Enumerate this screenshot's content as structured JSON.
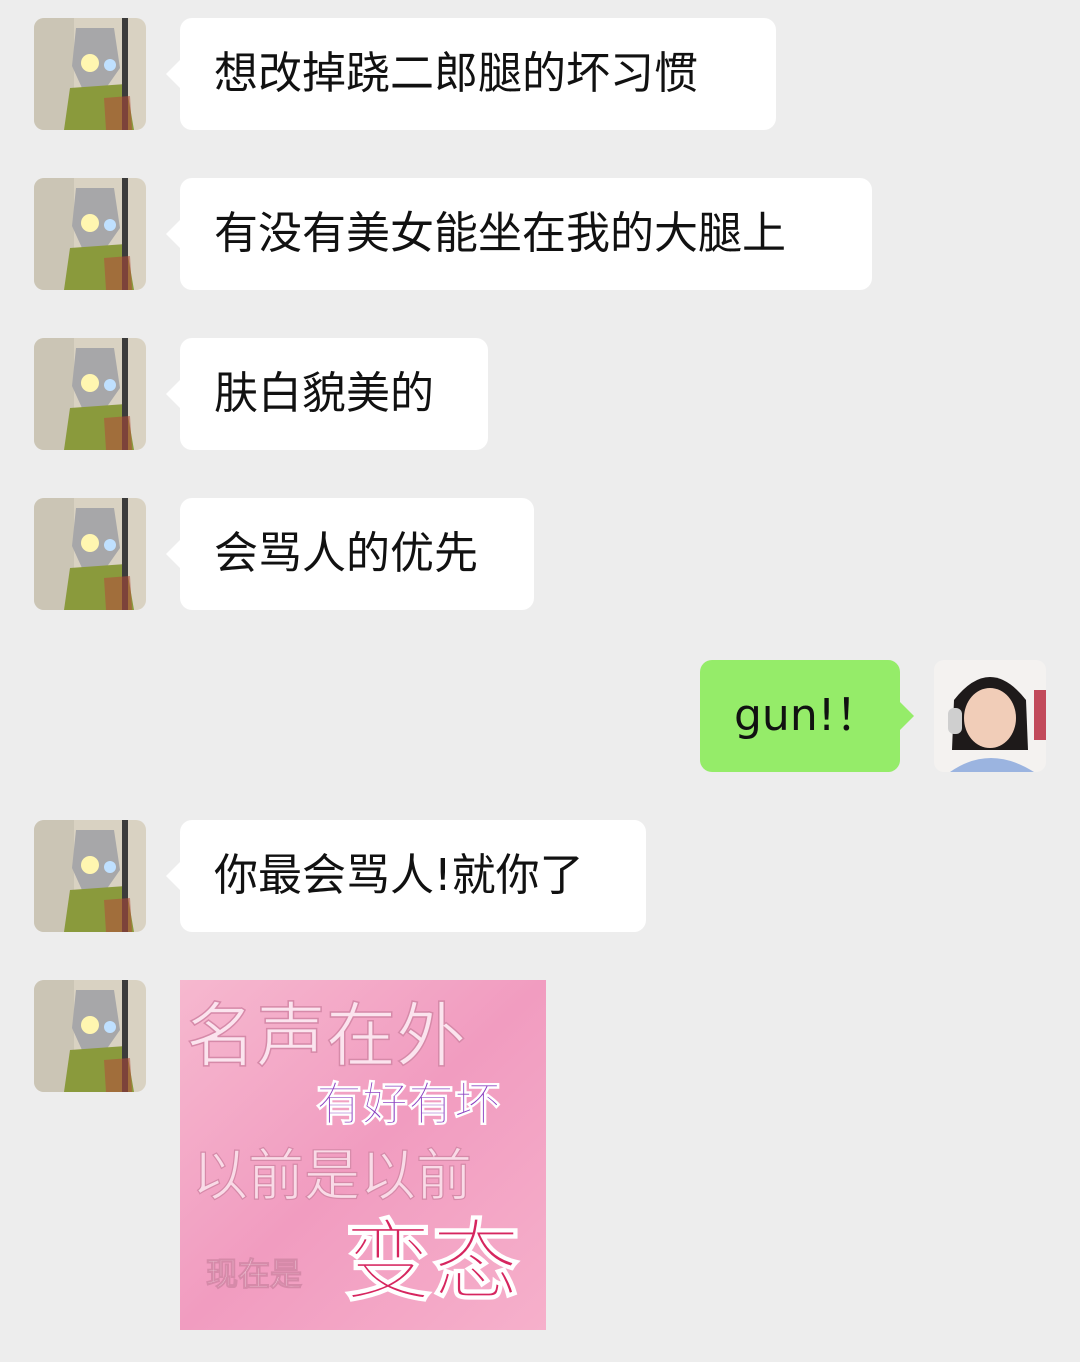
{
  "messages": [
    {
      "side": "left",
      "text": "想改掉跷二郎腿的坏习惯"
    },
    {
      "side": "left",
      "text": "有没有美女能坐在我的大腿上"
    },
    {
      "side": "left",
      "text": "肤白貌美的"
    },
    {
      "side": "left",
      "text": "会骂人的优先"
    },
    {
      "side": "right",
      "text": "gun!！"
    },
    {
      "side": "left",
      "text": "你最会骂人!就你了"
    }
  ],
  "sticker": {
    "line1": "名声在外",
    "line2": "有好有坏",
    "line3": "以前是以前",
    "line4_small": "现在是",
    "line4_big": "变态"
  },
  "colors": {
    "background": "#ededed",
    "bubble_left": "#ffffff",
    "bubble_right": "#95ec69",
    "sticker_bg": "#f3a7c6"
  }
}
